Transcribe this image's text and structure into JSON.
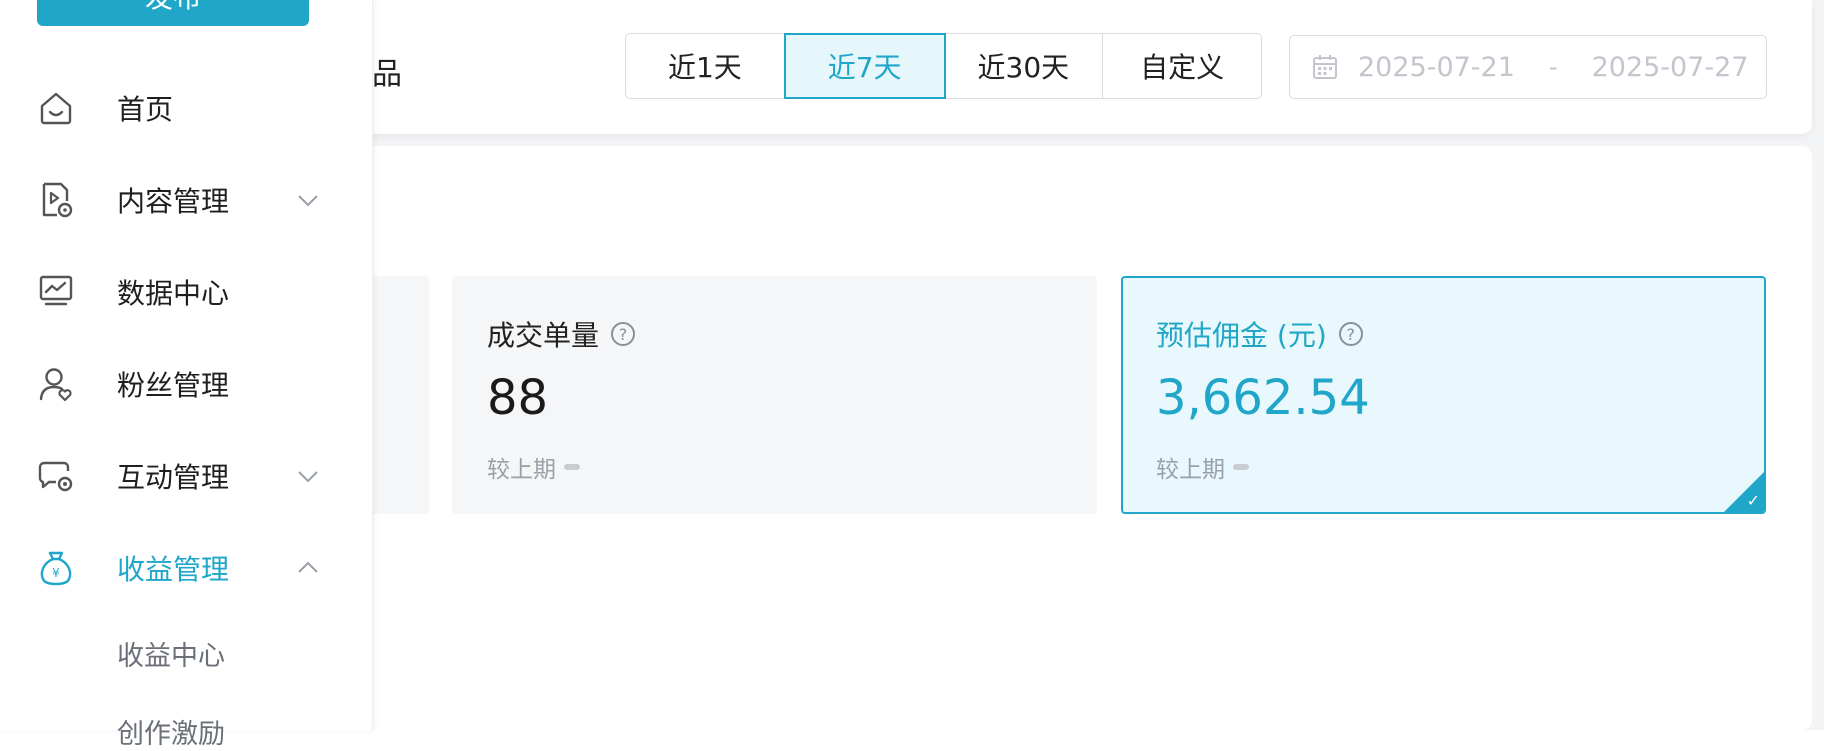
{
  "colors": {
    "accent": "#1fa6c8",
    "text": "#1f1f1f",
    "muted": "#9aa0a8"
  },
  "sidebar": {
    "publish_label": "发布",
    "items": [
      {
        "label": "首页",
        "icon": "home-icon",
        "expandable": false,
        "active": false
      },
      {
        "label": "内容管理",
        "icon": "content-icon",
        "expandable": true,
        "expanded": false,
        "active": false
      },
      {
        "label": "数据中心",
        "icon": "chart-monitor-icon",
        "expandable": false,
        "active": false
      },
      {
        "label": "粉丝管理",
        "icon": "user-heart-icon",
        "expandable": false,
        "active": false
      },
      {
        "label": "互动管理",
        "icon": "chat-gear-icon",
        "expandable": true,
        "expanded": false,
        "active": false
      },
      {
        "label": "收益管理",
        "icon": "money-bag-icon",
        "expandable": true,
        "expanded": true,
        "active": true
      }
    ],
    "subitems": [
      {
        "label": "收益中心"
      },
      {
        "label": "创作激励"
      }
    ]
  },
  "filter": {
    "title": "商品",
    "ranges": [
      {
        "label": "近1天",
        "selected": false
      },
      {
        "label": "近7天",
        "selected": true
      },
      {
        "label": "近30天",
        "selected": false
      },
      {
        "label": "自定义",
        "selected": false
      }
    ],
    "date_start": "2025-07-21",
    "date_separator": "-",
    "date_end": "2025-07-27"
  },
  "stats": {
    "orders": {
      "label": "成交单量",
      "value": "88",
      "compare_label": "较上期"
    },
    "commission": {
      "label": "预估佣金 (元)",
      "value": "3,662.54",
      "compare_label": "较上期",
      "selected": true
    }
  }
}
